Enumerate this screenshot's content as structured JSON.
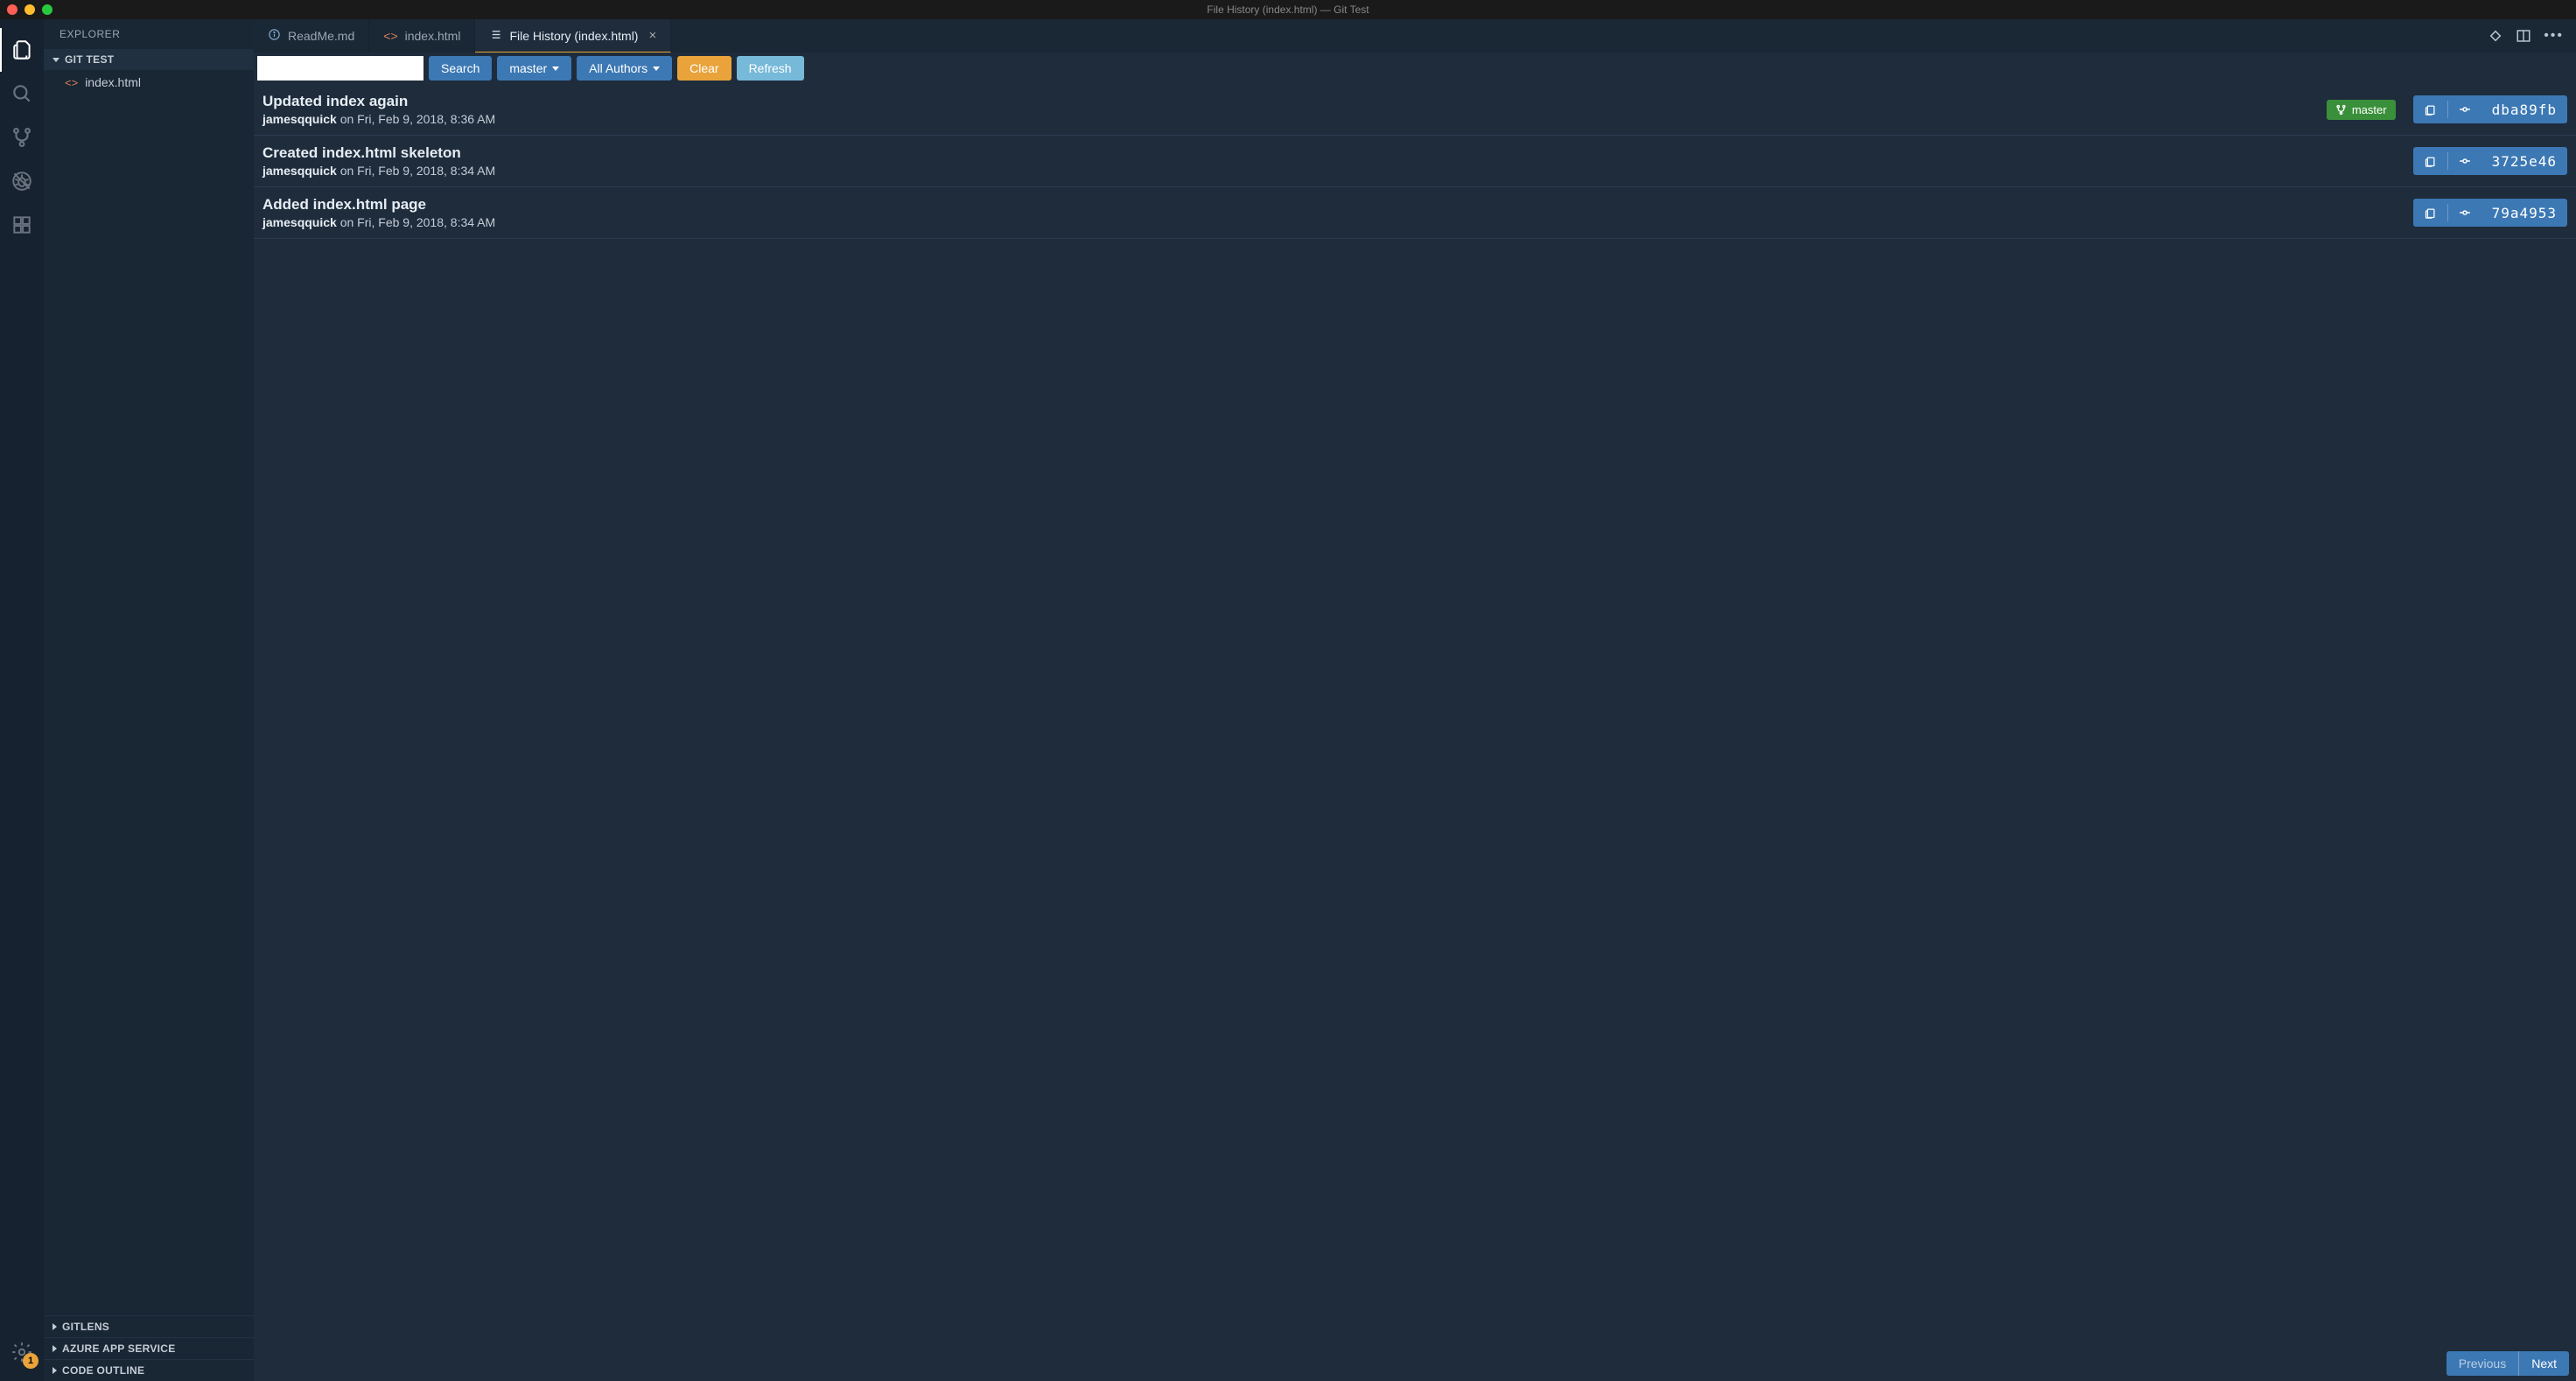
{
  "titlebar": {
    "title": "File History (index.html) — Git Test"
  },
  "activitybar": {
    "badge_count": "1"
  },
  "sidebar": {
    "title": "EXPLORER",
    "section_header": "GIT TEST",
    "files": [
      {
        "name": "index.html"
      }
    ],
    "bottom_sections": [
      {
        "label": "GITLENS"
      },
      {
        "label": "AZURE APP SERVICE"
      },
      {
        "label": "CODE OUTLINE"
      }
    ]
  },
  "tabs": [
    {
      "label": "ReadMe.md",
      "icon": "info"
    },
    {
      "label": "index.html",
      "icon": "code"
    },
    {
      "label": "File History (index.html)",
      "icon": "list",
      "active": true,
      "closable": true
    }
  ],
  "toolbar": {
    "search_placeholder": "",
    "search_label": "Search",
    "branch_label": "master",
    "authors_label": "All Authors",
    "clear_label": "Clear",
    "refresh_label": "Refresh"
  },
  "commits": [
    {
      "message": "Updated index again",
      "author": "jamesqquick",
      "meta": "on Fri, Feb 9, 2018, 8:36 AM",
      "branch": "master",
      "hash": "dba89fb"
    },
    {
      "message": "Created index.html skeleton",
      "author": "jamesqquick",
      "meta": "on Fri, Feb 9, 2018, 8:34 AM",
      "hash": "3725e46"
    },
    {
      "message": "Added index.html page",
      "author": "jamesqquick",
      "meta": "on Fri, Feb 9, 2018, 8:34 AM",
      "hash": "79a4953"
    }
  ],
  "nav": {
    "previous_label": "Previous",
    "next_label": "Next"
  }
}
